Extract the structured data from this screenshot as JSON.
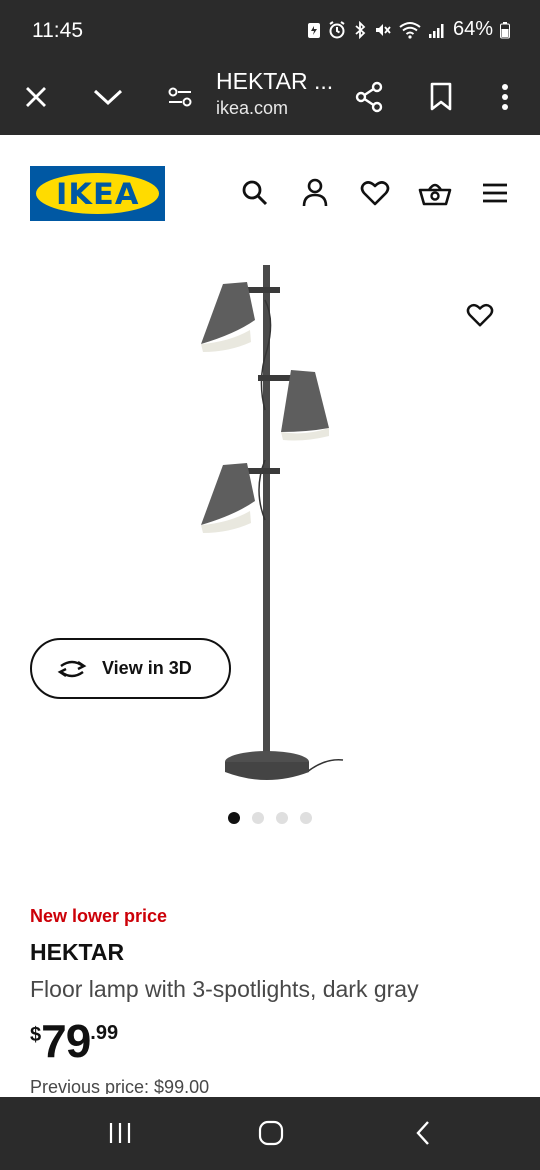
{
  "status_bar": {
    "time": "11:45",
    "battery": "64%",
    "icons": [
      "battery-saver-icon",
      "alarm-icon",
      "bluetooth-icon",
      "mute-icon",
      "wifi-icon",
      "signal-icon",
      "battery-icon"
    ]
  },
  "browser": {
    "title": "HEKTAR ...",
    "domain": "ikea.com",
    "buttons": [
      "close-icon",
      "chevron-down-icon",
      "tune-icon",
      "share-icon",
      "bookmark-icon",
      "more-vert-icon"
    ]
  },
  "header": {
    "logo_text": "IKEA",
    "icons": [
      "search-icon",
      "account-icon",
      "heart-icon",
      "basket-icon",
      "menu-icon"
    ]
  },
  "media": {
    "view_3d_label": "View in 3D",
    "dots_total": 4,
    "dots_active": 1
  },
  "product": {
    "badge": "New lower price",
    "name": "HEKTAR",
    "description": "Floor lamp with 3-spotlights, dark gray",
    "price": {
      "currency": "$",
      "integer": "79",
      "decimal": ".99"
    },
    "previous_price": "Previous price: $99.00"
  },
  "colors": {
    "ikea_blue": "#0058a3",
    "ikea_yellow": "#ffdb00",
    "badge_red": "#cc0008",
    "chrome_dark": "#2b2b2b"
  }
}
